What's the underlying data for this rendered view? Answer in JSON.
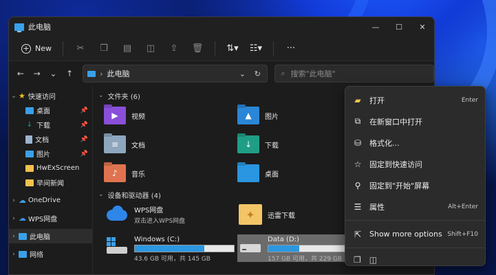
{
  "window": {
    "title": "此电脑",
    "controls": [
      "—",
      "☐",
      "✕"
    ]
  },
  "toolbar": {
    "new_label": "New",
    "more_label": "···"
  },
  "navbar": {
    "path": "此电脑",
    "search_placeholder": "搜索\"此电脑\""
  },
  "sidebar": {
    "items": [
      {
        "label": "快速访问",
        "icon": "star-icon",
        "color": "#f2c319"
      },
      {
        "label": "桌面",
        "icon": "desktop-icon",
        "color": "#3aa0e8"
      },
      {
        "label": "下载",
        "icon": "download-icon",
        "color": "#2aa198"
      },
      {
        "label": "文档",
        "icon": "document-icon",
        "color": "#9ab4cf"
      },
      {
        "label": "图片",
        "icon": "pictures-icon",
        "color": "#3aa0e8"
      },
      {
        "label": "HwExScreen",
        "icon": "folder-icon",
        "color": "#f2c14e"
      },
      {
        "label": "早间新闻",
        "icon": "folder-icon",
        "color": "#f2c14e"
      },
      {
        "label": "OneDrive",
        "icon": "cloud-icon",
        "color": "#3aa0e8"
      },
      {
        "label": "WPS网盘",
        "icon": "cloud-icon",
        "color": "#3a8fe8"
      },
      {
        "label": "此电脑",
        "icon": "computer-icon",
        "color": "#3aa0e8"
      },
      {
        "label": "网络",
        "icon": "network-icon",
        "color": "#3aa0e8"
      }
    ]
  },
  "main": {
    "folders_header": "文件夹 (6)",
    "folders": [
      {
        "label": "视频",
        "icon": "videos-folder-icon",
        "color": "#8a4fd8",
        "glyph": "▶"
      },
      {
        "label": "图片",
        "icon": "pictures-folder-icon",
        "color": "#2a86d6",
        "glyph": "▲"
      },
      {
        "label": "文档",
        "icon": "documents-folder-icon",
        "color": "#8ea6be",
        "glyph": "≡"
      },
      {
        "label": "下载",
        "icon": "downloads-folder-icon",
        "color": "#1f9e86",
        "glyph": "↓"
      },
      {
        "label": "音乐",
        "icon": "music-folder-icon",
        "color": "#e0734f",
        "glyph": "♪"
      },
      {
        "label": "桌面",
        "icon": "desktop-folder-icon",
        "color": "#2a95e0",
        "glyph": ""
      }
    ],
    "drives_header": "设备和驱动器 (4)",
    "drives": [
      {
        "name": "WPS网盘",
        "sub": "双击进入WPS网盘",
        "icon": "wps-cloud-icon",
        "bar": false
      },
      {
        "name": "迅雷下载",
        "sub": "",
        "icon": "xunlei-icon",
        "bar": false
      },
      {
        "name": "Windows (C:)",
        "sub": "43.6 GB 可用，共 145 GB",
        "icon": "windows-drive-icon",
        "bar": true,
        "used_fraction": 0.7
      },
      {
        "name": "Data (D:)",
        "sub": "157 GB 可用，共 229 GB",
        "icon": "drive-icon",
        "bar": true,
        "used_fraction": 0.31
      }
    ]
  },
  "context_menu": {
    "items": [
      {
        "label": "打开",
        "shortcut": "Enter",
        "icon": "folder-open-icon"
      },
      {
        "label": "在新窗口中打开",
        "shortcut": "",
        "icon": "open-new-window-icon"
      },
      {
        "label": "格式化...",
        "shortcut": "",
        "icon": "format-drive-icon"
      },
      {
        "label": "固定到快速访问",
        "shortcut": "",
        "icon": "star-outline-icon"
      },
      {
        "label": "固定到\"开始\"屏幕",
        "shortcut": "",
        "icon": "pin-icon"
      },
      {
        "label": "属性",
        "shortcut": "Alt+Enter",
        "icon": "properties-icon"
      }
    ],
    "more": {
      "label": "Show more options",
      "shortcut": "Shift+F10",
      "icon": "more-options-icon"
    }
  }
}
